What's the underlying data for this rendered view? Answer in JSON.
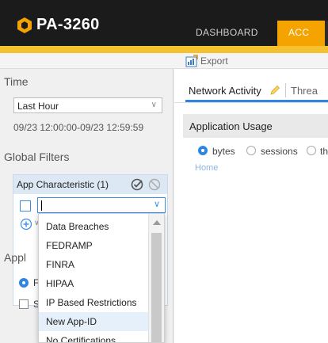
{
  "header": {
    "product": "PA-3260",
    "tabs": [
      "DASHBOARD",
      "ACC"
    ]
  },
  "toolbar": {
    "export_label": "Export"
  },
  "sidebar": {
    "time_title": "Time",
    "time_select": "Last Hour",
    "time_range": "09/23 12:00:00-09/23 12:59:59",
    "global_filters_title": "Global Filters",
    "filter_title": "App Characteristic (1)",
    "application_title_partial": "Appl",
    "radio_partial": "F",
    "checkbox_partial": "S"
  },
  "dropdown": {
    "items": [
      "Data Breaches",
      "FEDRAMP",
      "FINRA",
      "HIPAA",
      "IP Based Restrictions",
      "New App-ID",
      "No Certifications"
    ],
    "highlighted": "New App-ID"
  },
  "main": {
    "tab_network": "Network Activity",
    "tab_threat_partial": "Threa",
    "widget_title": "Application Usage",
    "options": [
      "bytes",
      "sessions",
      "th"
    ],
    "home_link": "Home"
  },
  "colors": {
    "accent": "#f5c131",
    "tab_active": "#f4a300",
    "primary_blue": "#2f86e0"
  }
}
